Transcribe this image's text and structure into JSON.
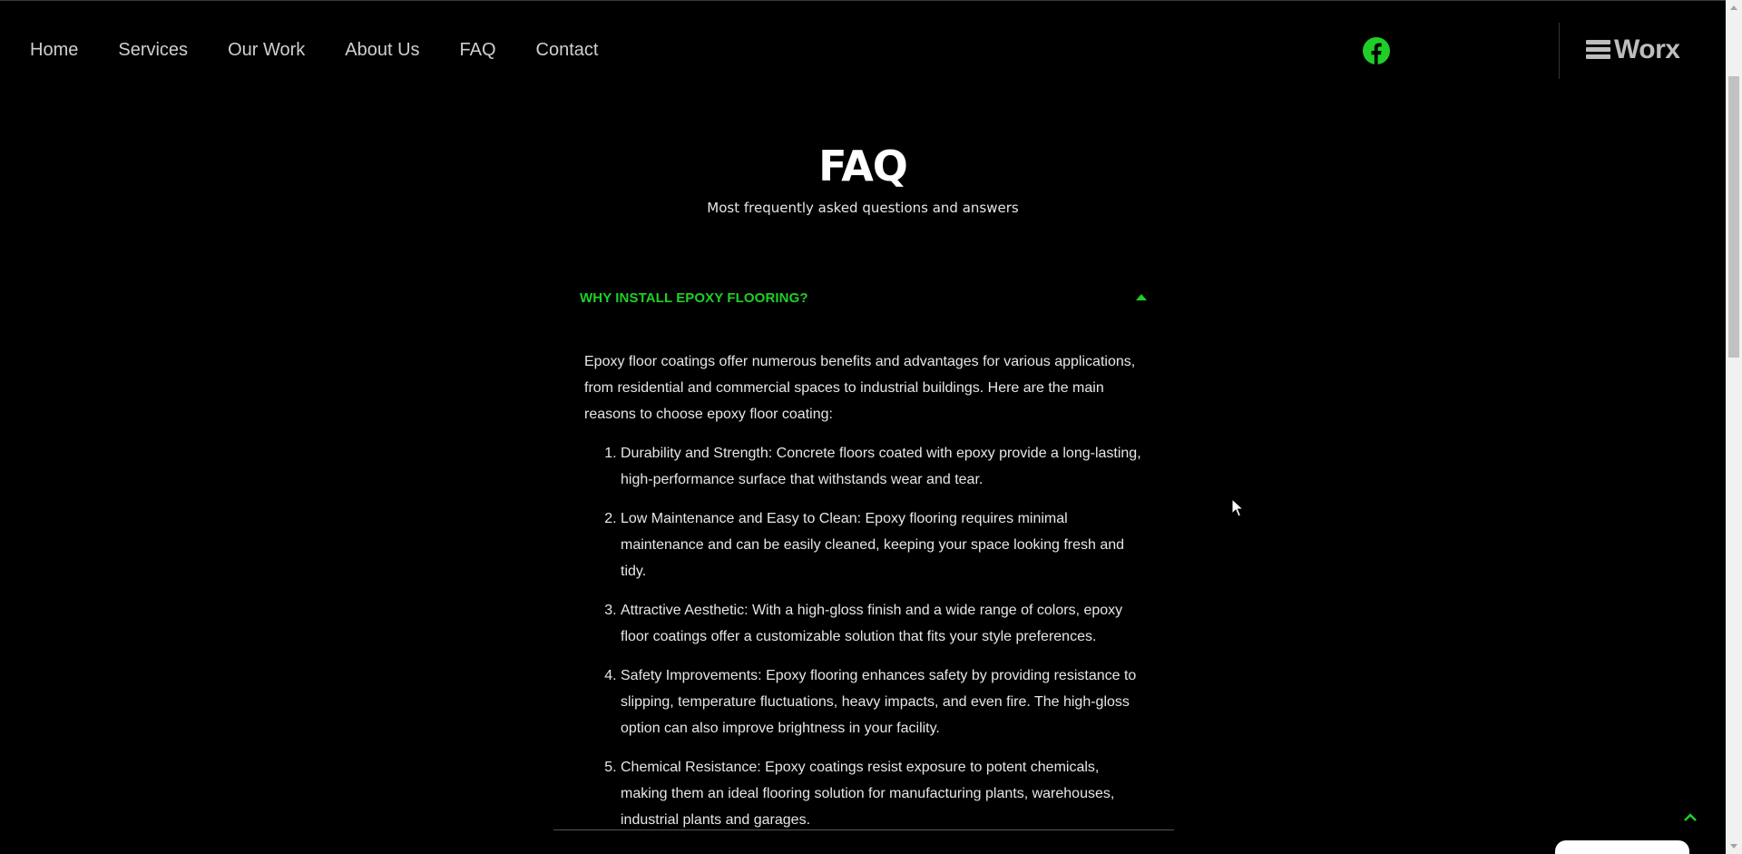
{
  "nav": {
    "items": [
      {
        "label": "Home"
      },
      {
        "label": "Services"
      },
      {
        "label": "Our Work"
      },
      {
        "label": "About Us"
      },
      {
        "label": "FAQ"
      },
      {
        "label": "Contact"
      }
    ]
  },
  "header": {
    "social_icon": "facebook-icon",
    "logo_text": "Worx",
    "menu_icon": "hamburger-icon"
  },
  "faq": {
    "title": "FAQ",
    "subtitle": "Most frequently asked questions and answers",
    "items": [
      {
        "question": "WHY INSTALL EPOXY FLOORING?",
        "expanded": true,
        "intro": "Epoxy floor coatings offer numerous benefits and advantages for various applications, from residential and commercial spaces to industrial buildings. Here are the main reasons to choose epoxy floor coating:",
        "points": [
          "Durability and Strength: Concrete floors coated with epoxy provide a long-lasting, high-performance surface that withstands wear and tear.",
          "Low Maintenance and Easy to Clean: Epoxy flooring requires minimal maintenance and can be easily cleaned, keeping your space looking fresh and tidy.",
          "Attractive Aesthetic: With a high-gloss finish and a wide range of colors, epoxy floor coatings offer a customizable solution that fits your style preferences.",
          "Safety Improvements: Epoxy flooring enhances safety by providing resistance to slipping, temperature fluctuations, heavy impacts, and even fire. The high-gloss option can also improve brightness in your facility.",
          "Chemical Resistance: Epoxy coatings resist exposure to potent chemicals, making them an ideal flooring solution for manufacturing plants, warehouses, industrial plants and garages."
        ]
      }
    ]
  },
  "colors": {
    "accent": "#1fcf27",
    "background": "#000000",
    "text": "#e6e6e6"
  },
  "scroll_top_icon": "chevron-up-icon"
}
